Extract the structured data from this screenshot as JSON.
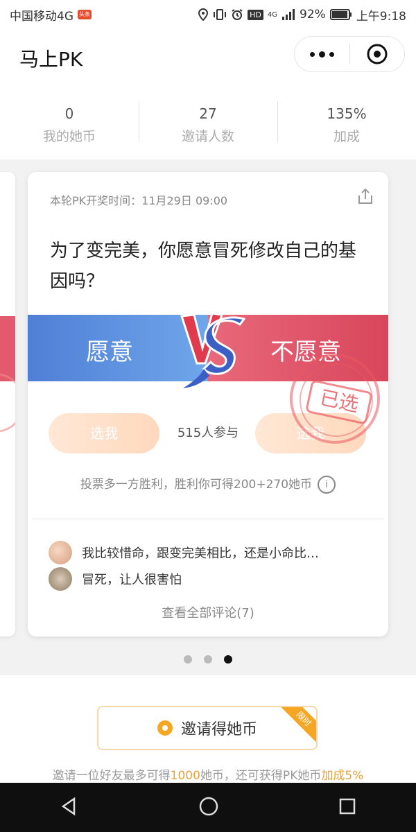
{
  "status_bar": {
    "carrier": "中国移动4G",
    "app_badge": "头条",
    "hd": "HD",
    "network": "4G",
    "battery": "92%",
    "time": "上午9:18"
  },
  "header": {
    "title": "马上PK"
  },
  "stats": [
    {
      "value": "0",
      "label": "我的她币"
    },
    {
      "value": "27",
      "label": "邀请人数"
    },
    {
      "value": "135%",
      "label": "加成"
    }
  ],
  "card": {
    "time_label": "本轮PK开奖时间：11月29日 09:00",
    "question": "为了变完美，你愿意冒死修改自己的基因吗？",
    "left_option": "愿意",
    "right_option": "不愿意",
    "pick_left": "选我",
    "pick_right": "选我",
    "participants": "515人参与",
    "stamp": "已选",
    "rule": "投票多一方胜利，胜利你可得200+270她币",
    "rule_icon": "i",
    "comments": [
      {
        "text": "我比较惜命，跟变完美相比，还是小命比…"
      },
      {
        "text": "冒死，让人很害怕"
      }
    ],
    "all_comments": "查看全部评论(7)"
  },
  "pager": {
    "count": 3,
    "active": 2
  },
  "invite": {
    "button_label": "邀请得她币",
    "ribbon": "限时",
    "note_prefix": "邀请一位好友最多可得",
    "note_amount": "1000",
    "note_mid": "她币，还可获得PK她币",
    "note_bonus": "加成5%"
  },
  "colors": {
    "accent_orange": "#f5a623",
    "blue": "#4f7fd6",
    "red": "#e35a6e"
  }
}
